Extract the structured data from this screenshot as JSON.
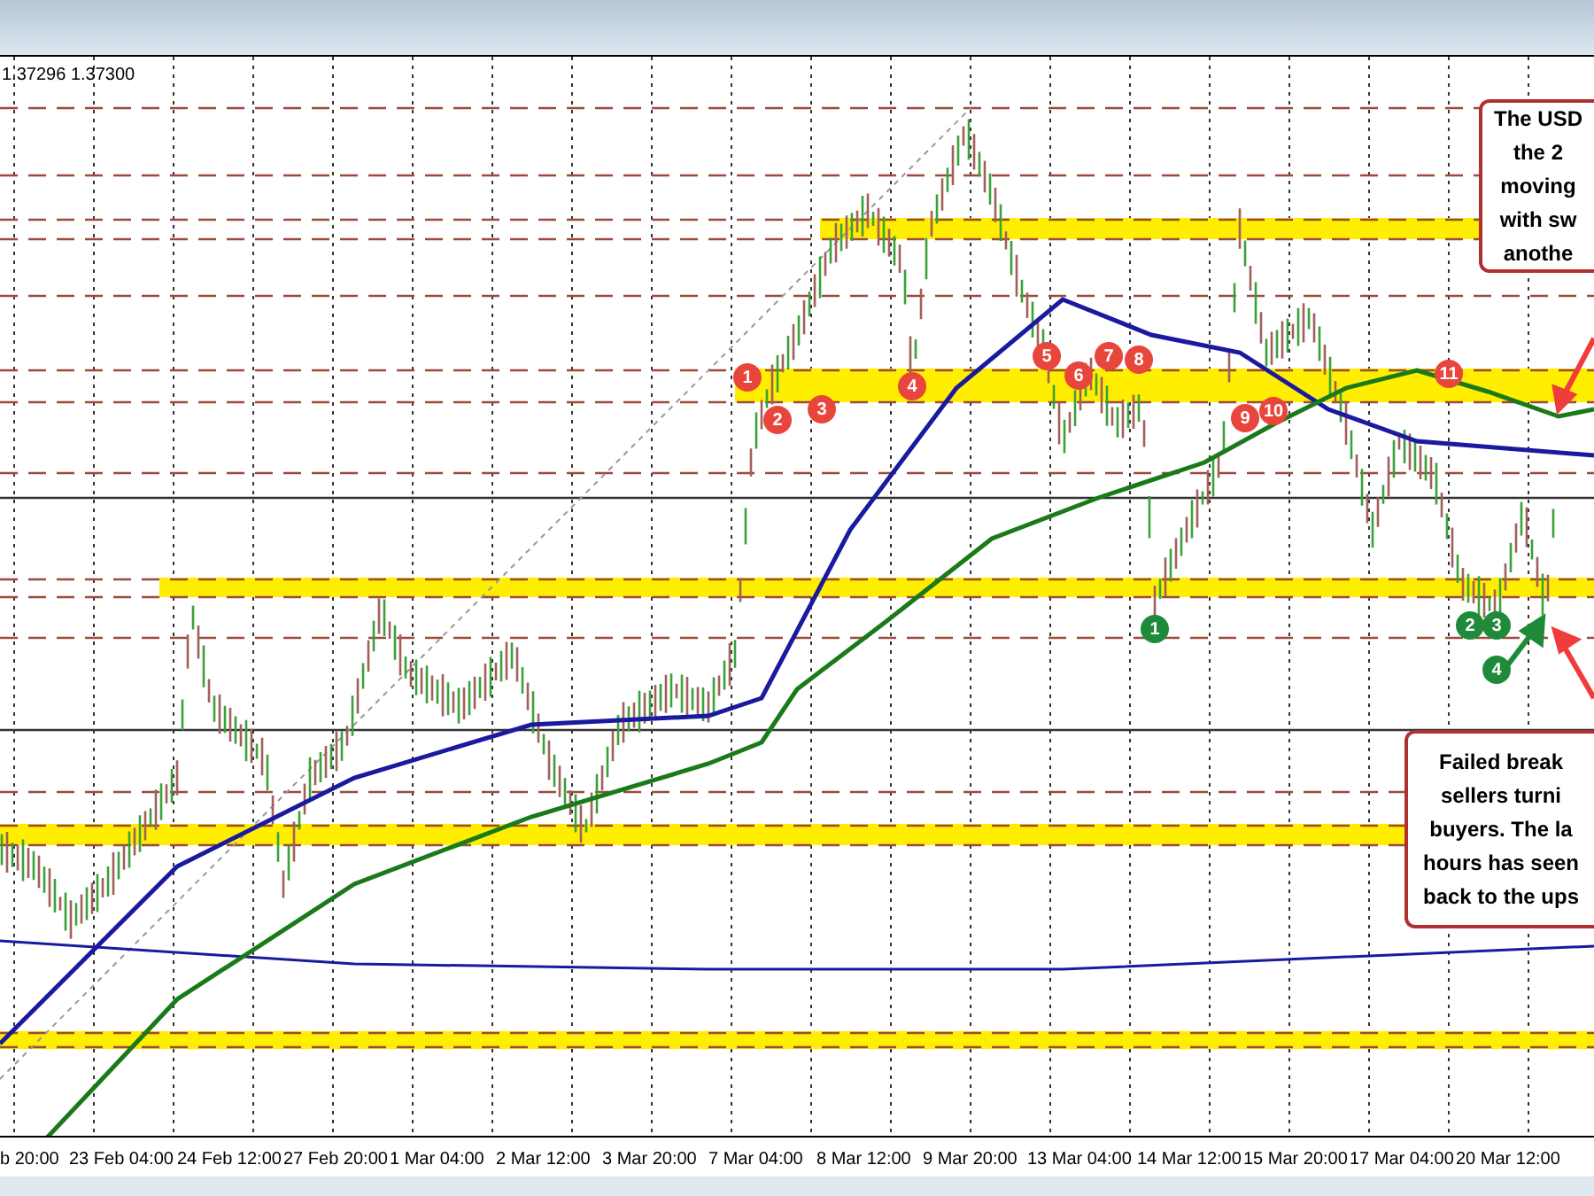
{
  "chart_header": {
    "bid": "1.37296",
    "ask": "1.37300"
  },
  "markers": [
    {
      "label": "1",
      "color": "#e8463c"
    },
    {
      "label": "2",
      "color": "#e8463c"
    },
    {
      "label": "3",
      "color": "#e8463c"
    },
    {
      "label": "4",
      "color": "#e8463c"
    },
    {
      "label": "5",
      "color": "#e8463c"
    },
    {
      "label": "6",
      "color": "#e8463c"
    },
    {
      "label": "7",
      "color": "#e8463c"
    },
    {
      "label": "8",
      "color": "#e8463c"
    },
    {
      "label": "9",
      "color": "#e8463c"
    },
    {
      "label": "10",
      "color": "#e8463c"
    },
    {
      "label": "11",
      "color": "#e8463c"
    },
    {
      "label": "1",
      "color": "#1f8a3a"
    },
    {
      "label": "2",
      "color": "#1f8a3a"
    },
    {
      "label": "3",
      "color": "#1f8a3a"
    },
    {
      "label": "4",
      "color": "#1f8a3a"
    }
  ],
  "annotations": [
    {
      "lines": [
        "The USD",
        "the 2",
        "moving",
        "with sw",
        "anothe"
      ]
    },
    {
      "lines": [
        "Failed break",
        "sellers turni",
        "buyers. The la",
        "hours has seen",
        "back to the ups"
      ]
    }
  ],
  "x_axis": {
    "labels": [
      "b 20:00",
      "23 Feb 04:00",
      "24 Feb 12:00",
      "27 Feb 20:00",
      "1 Mar 04:00",
      "2 Mar 12:00",
      "3 Mar 20:00",
      "7 Mar 04:00",
      "8 Mar 12:00",
      "9 Mar 20:00",
      "13 Mar 04:00",
      "14 Mar 12:00",
      "15 Mar 20:00",
      "17 Mar 04:00",
      "20 Mar 12:00"
    ]
  }
}
